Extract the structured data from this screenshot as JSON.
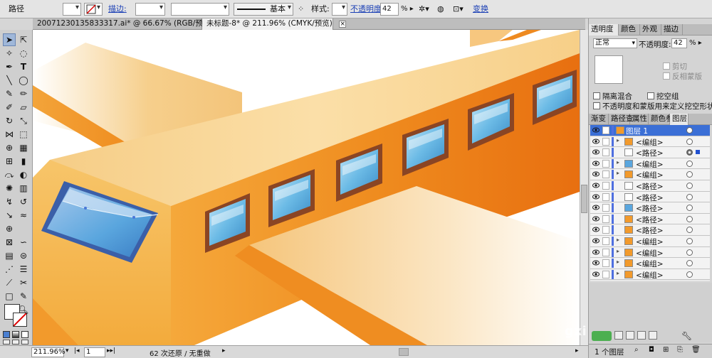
{
  "control_bar": {
    "object_type": "路径",
    "stroke_label": "描边:",
    "stroke_profile": "基本",
    "style_label": "样式:",
    "opacity_label": "不透明度",
    "opacity_value": "42",
    "opacity_unit": "%",
    "transform_link": "变换"
  },
  "doc_tabs": [
    {
      "label": "20071230135833317.ai* @ 66.67% (RGB/预览)",
      "active": false
    },
    {
      "label": "未标题-8* @ 211.96% (CMYK/预览)",
      "active": true
    }
  ],
  "status_bar": {
    "zoom": "211.96%",
    "artboard": "1",
    "history": "62 次还原 / 无重做"
  },
  "transparency_panel": {
    "tabs": [
      "透明度",
      "颜色",
      "外观",
      "描边"
    ],
    "blend_mode": "正常",
    "opacity_label": "不透明度:",
    "opacity_value": "42",
    "opacity_unit": "%",
    "clip_label": "剪切",
    "invert_mask_label": "反相蒙版",
    "isolate_blending": "隔离混合",
    "knockout_group": "挖空组",
    "opacity_mask_define": "不透明度和蒙版用来定义挖空形状"
  },
  "layers_panel": {
    "tabs": [
      "渐变",
      "路径查",
      "属性",
      "颜色参",
      "图层"
    ],
    "layers": [
      {
        "name": "图层 1",
        "level": "top",
        "expand": "▾",
        "thumb": "orange",
        "selected": false,
        "target": false
      },
      {
        "name": "<编组>",
        "level": "child",
        "expand": "▸",
        "thumb": "orange",
        "selected": false,
        "target": false
      },
      {
        "name": "<路径>",
        "level": "child",
        "expand": "",
        "thumb": "white",
        "selected": true,
        "target": true
      },
      {
        "name": "<编组>",
        "level": "child",
        "expand": "▸",
        "thumb": "blue",
        "selected": false,
        "target": false
      },
      {
        "name": "<编组>",
        "level": "child",
        "expand": "▸",
        "thumb": "orange",
        "selected": false,
        "target": false
      },
      {
        "name": "<路径>",
        "level": "child",
        "expand": "",
        "thumb": "white",
        "selected": false,
        "target": false
      },
      {
        "name": "<路径>",
        "level": "child",
        "expand": "",
        "thumb": "white",
        "selected": false,
        "target": false
      },
      {
        "name": "<路径>",
        "level": "child",
        "expand": "",
        "thumb": "blue",
        "selected": false,
        "target": false
      },
      {
        "name": "<路径>",
        "level": "child",
        "expand": "",
        "thumb": "orange",
        "selected": false,
        "target": false
      },
      {
        "name": "<路径>",
        "level": "child",
        "expand": "",
        "thumb": "orange",
        "selected": false,
        "target": false
      },
      {
        "name": "<编组>",
        "level": "child",
        "expand": "▸",
        "thumb": "orange",
        "selected": false,
        "target": false
      },
      {
        "name": "<编组>",
        "level": "child",
        "expand": "▸",
        "thumb": "orange",
        "selected": false,
        "target": false
      },
      {
        "name": "<编组>",
        "level": "child",
        "expand": "▸",
        "thumb": "orange",
        "selected": false,
        "target": false
      },
      {
        "name": "<编组>",
        "level": "child",
        "expand": "▸",
        "thumb": "orange",
        "selected": false,
        "target": false
      }
    ],
    "layer_count": "1 个图层"
  },
  "watermark": "gxi",
  "colors": {
    "layer_highlight": "#3b6fd6",
    "fuselage_orange": "#f08a1e",
    "fuselage_top": "#f9d79a",
    "window_blue": "#5ab0e0",
    "window_frame": "#8a4a24"
  }
}
